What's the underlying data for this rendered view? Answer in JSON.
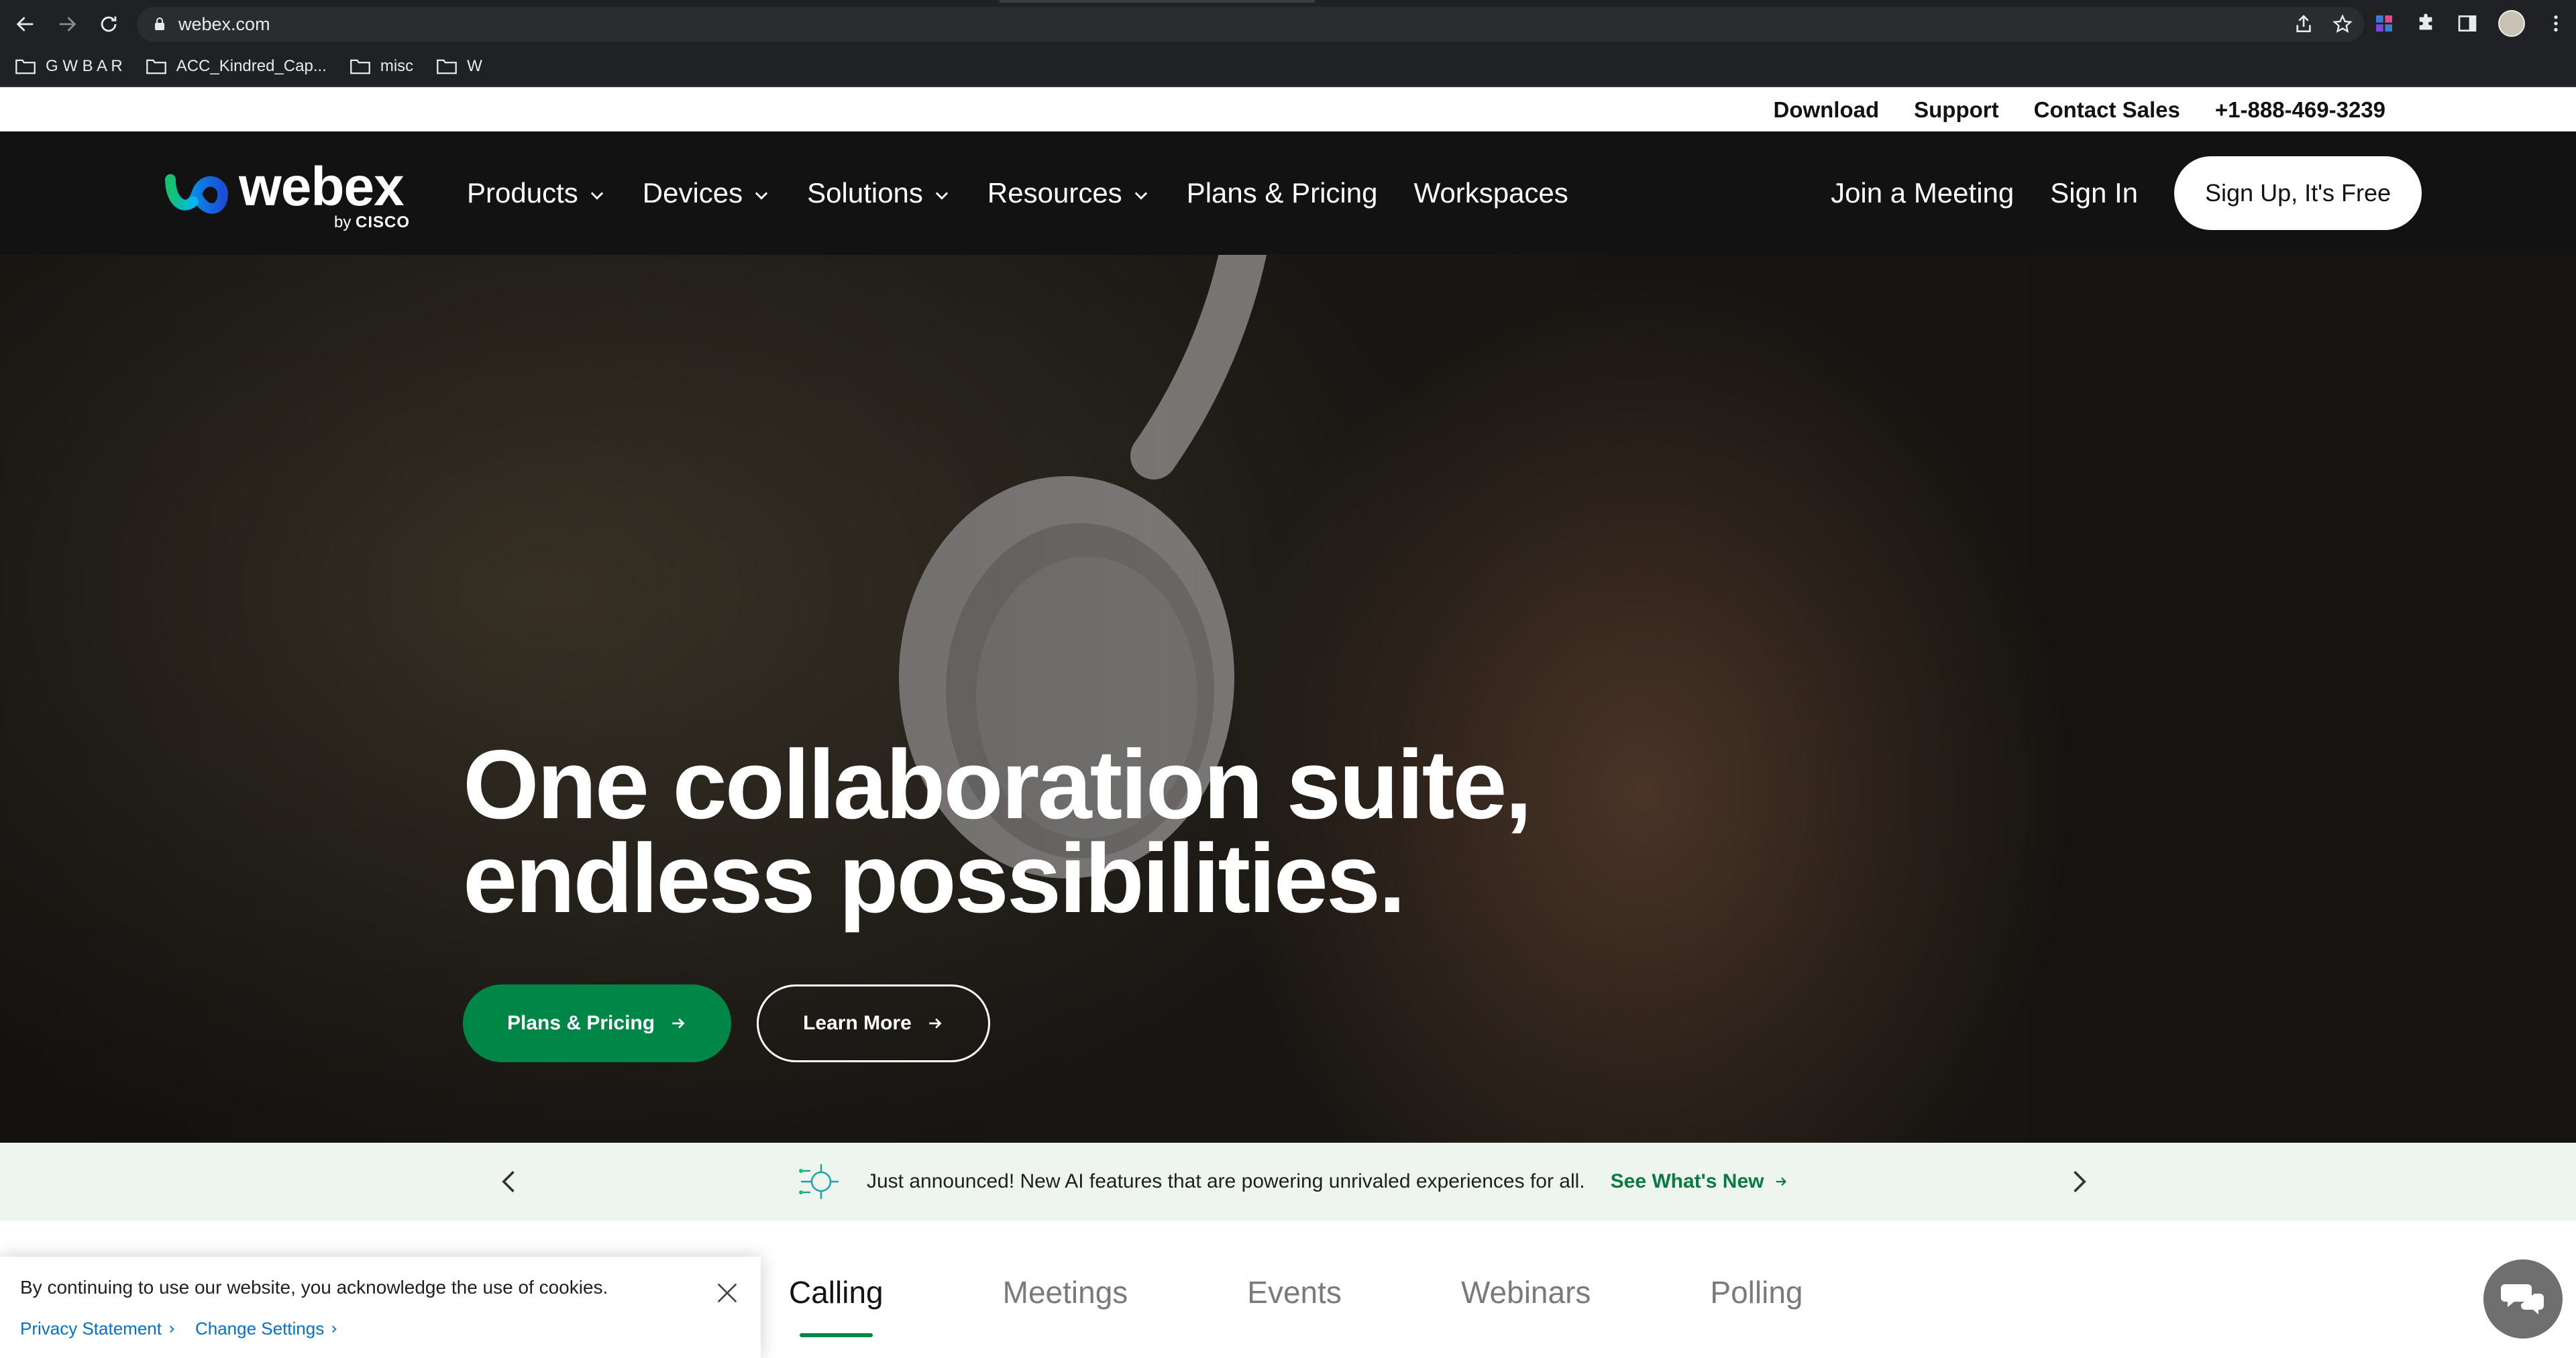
{
  "browser": {
    "url": "webex.com",
    "bookmarks": [
      "G W B A R",
      "ACC_Kindred_Cap...",
      "misc",
      "W"
    ]
  },
  "utility": {
    "download": "Download",
    "support": "Support",
    "contact_sales": "Contact Sales",
    "phone": "+1-888-469-3239"
  },
  "nav": {
    "logo_word": "webex",
    "logo_by": "by",
    "logo_cisco": "CISCO",
    "items": [
      {
        "label": "Products",
        "has_dropdown": true
      },
      {
        "label": "Devices",
        "has_dropdown": true
      },
      {
        "label": "Solutions",
        "has_dropdown": true
      },
      {
        "label": "Resources",
        "has_dropdown": true
      },
      {
        "label": "Plans & Pricing",
        "has_dropdown": false
      },
      {
        "label": "Workspaces",
        "has_dropdown": false
      }
    ],
    "join_meeting": "Join a Meeting",
    "sign_in": "Sign In",
    "sign_up": "Sign Up, It's Free"
  },
  "hero": {
    "headline_line1": "One collaboration suite,",
    "headline_line2": "endless possibilities.",
    "primary_button": "Plans & Pricing",
    "secondary_button": "Learn More"
  },
  "announcement": {
    "message": "Just announced! New AI features that are powering unrivaled experiences for all.",
    "link": "See What's New"
  },
  "tabs": [
    {
      "label": "Calling",
      "active": true
    },
    {
      "label": "Meetings",
      "active": false
    },
    {
      "label": "Events",
      "active": false
    },
    {
      "label": "Webinars",
      "active": false
    },
    {
      "label": "Polling",
      "active": false
    }
  ],
  "cookie": {
    "text": "By continuing to use our website, you acknowledge the use of cookies.",
    "privacy": "Privacy Statement",
    "settings": "Change Settings"
  },
  "colors": {
    "brand_green": "#008748",
    "nav_bg": "#121212",
    "link_blue": "#0070d2"
  }
}
